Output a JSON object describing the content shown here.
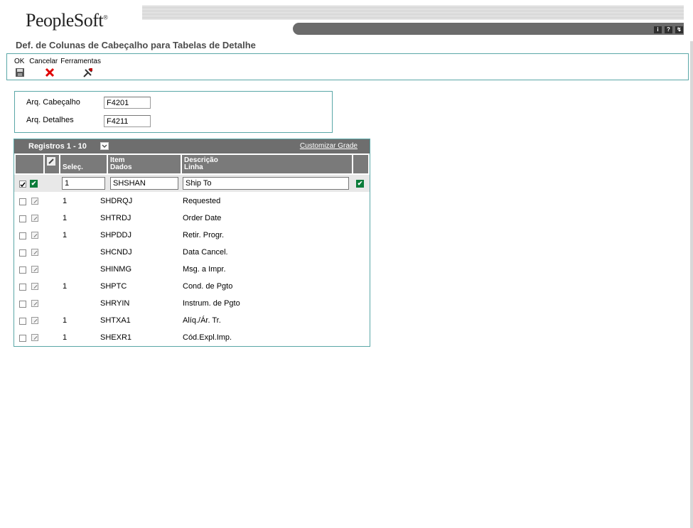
{
  "header": {
    "logo": "PeopleSoft",
    "logo_mark": "®",
    "icons": [
      "i",
      "?",
      "↯"
    ]
  },
  "page_title": "Def. de Colunas de Cabeçalho para Tabelas de Detalhe",
  "toolbar": {
    "ok_label": "OK",
    "cancel_label": "Cancelar",
    "tools_label": "Ferramentas"
  },
  "form": {
    "header_file_label": "Arq. Cabeçalho",
    "header_file_value": "F4201",
    "detail_file_label": "Arq. Detalhes",
    "detail_file_value": "F4211"
  },
  "grid": {
    "records_label": "Registros 1 - 10",
    "customize_label": "Customizar Grade",
    "columns": {
      "select": "Seleç.",
      "item_l1": "Item",
      "item_l2": "Dados",
      "desc_l1": "Descrição",
      "desc_l2": "Linha"
    },
    "rows": [
      {
        "sel": "1",
        "item": "SHSHAN",
        "desc": "Ship To"
      },
      {
        "sel": "1",
        "item": "SHDRQJ",
        "desc": "Requested"
      },
      {
        "sel": "1",
        "item": "SHTRDJ",
        "desc": "Order Date"
      },
      {
        "sel": "1",
        "item": "SHPDDJ",
        "desc": "Retir. Progr."
      },
      {
        "sel": "",
        "item": "SHCNDJ",
        "desc": "Data Cancel."
      },
      {
        "sel": "",
        "item": "SHINMG",
        "desc": "Msg. a Impr."
      },
      {
        "sel": "1",
        "item": "SHPTC",
        "desc": "Cond. de Pgto"
      },
      {
        "sel": "",
        "item": "SHRYIN",
        "desc": "Instrum. de Pgto"
      },
      {
        "sel": "1",
        "item": "SHTXA1",
        "desc": "Alíq./Ár. Tr."
      },
      {
        "sel": "1",
        "item": "SHEXR1",
        "desc": "Cód.Expl.Imp."
      }
    ]
  },
  "colors": {
    "accent_border": "#5aa7a7",
    "grid_header": "#6e6e6e",
    "check_green": "#0b7c3a",
    "cancel_red": "#e00000"
  }
}
